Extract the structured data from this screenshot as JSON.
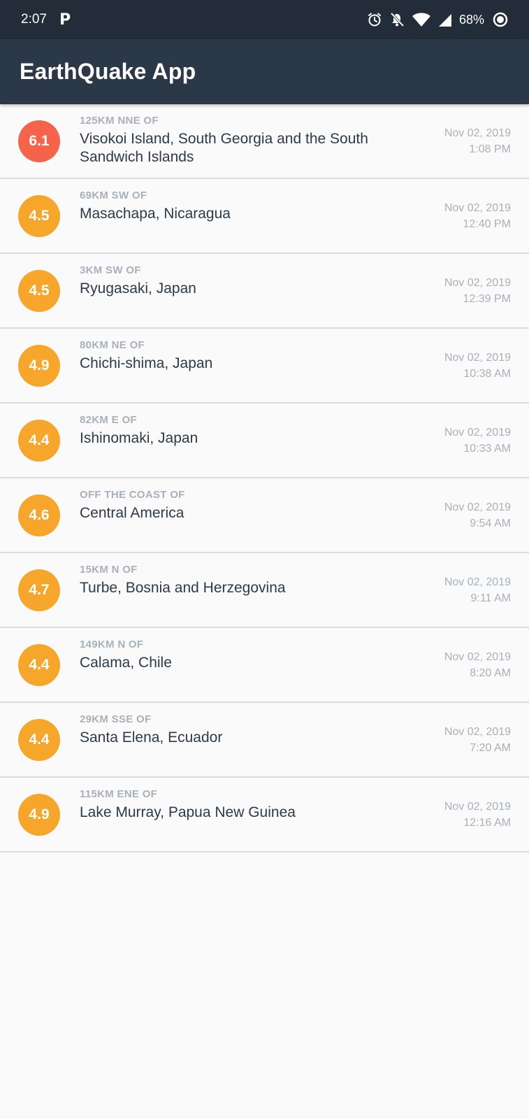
{
  "status_bar": {
    "time": "2:07",
    "app_letter": "P",
    "battery": "68%",
    "icons": [
      "alarm-icon",
      "notifications-off-icon",
      "wifi-icon",
      "signal-icon",
      "battery-icon"
    ]
  },
  "app_bar": {
    "title": "EarthQuake App"
  },
  "colors": {
    "status_bar": "#222d39",
    "app_bar": "#2b3847",
    "mag_high": "#f4634a",
    "mag_medium": "#f5a62b",
    "offset_text": "#a8b0b9",
    "primary_text": "#2d3a48"
  },
  "quakes": [
    {
      "magnitude": "6.1",
      "color": "#f4634a",
      "offset": "125KM NNE OF",
      "location": "Visokoi Island, South Georgia and the South Sandwich Islands",
      "date": "Nov 02, 2019",
      "time": "1:08 PM"
    },
    {
      "magnitude": "4.5",
      "color": "#f5a62b",
      "offset": "69KM SW OF",
      "location": "Masachapa, Nicaragua",
      "date": "Nov 02, 2019",
      "time": "12:40 PM"
    },
    {
      "magnitude": "4.5",
      "color": "#f5a62b",
      "offset": "3KM SW OF",
      "location": "Ryugasaki, Japan",
      "date": "Nov 02, 2019",
      "time": "12:39 PM"
    },
    {
      "magnitude": "4.9",
      "color": "#f5a62b",
      "offset": "80KM NE OF",
      "location": "Chichi-shima, Japan",
      "date": "Nov 02, 2019",
      "time": "10:38 AM"
    },
    {
      "magnitude": "4.4",
      "color": "#f5a62b",
      "offset": "82KM E OF",
      "location": "Ishinomaki, Japan",
      "date": "Nov 02, 2019",
      "time": "10:33 AM"
    },
    {
      "magnitude": "4.6",
      "color": "#f5a62b",
      "offset": "OFF THE COAST OF",
      "location": "Central America",
      "date": "Nov 02, 2019",
      "time": "9:54 AM"
    },
    {
      "magnitude": "4.7",
      "color": "#f5a62b",
      "offset": "15KM N OF",
      "location": "Turbe, Bosnia and Herzegovina",
      "date": "Nov 02, 2019",
      "time": "9:11 AM"
    },
    {
      "magnitude": "4.4",
      "color": "#f5a62b",
      "offset": "149KM N OF",
      "location": "Calama, Chile",
      "date": "Nov 02, 2019",
      "time": "8:20 AM"
    },
    {
      "magnitude": "4.4",
      "color": "#f5a62b",
      "offset": "29KM SSE OF",
      "location": "Santa Elena, Ecuador",
      "date": "Nov 02, 2019",
      "time": "7:20 AM"
    },
    {
      "magnitude": "4.9",
      "color": "#f5a62b",
      "offset": "115KM ENE OF",
      "location": "Lake Murray, Papua New Guinea",
      "date": "Nov 02, 2019",
      "time": "12:16 AM"
    }
  ]
}
